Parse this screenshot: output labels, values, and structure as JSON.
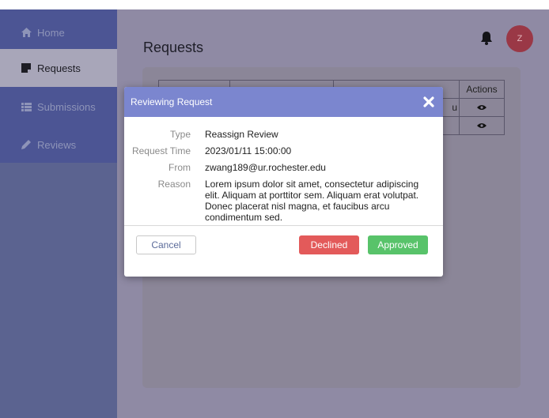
{
  "sidebar": {
    "items": [
      {
        "label": "Home",
        "icon": "home-icon"
      },
      {
        "label": "Requests",
        "icon": "note-icon",
        "active": true
      },
      {
        "label": "Submissions",
        "icon": "list-icon"
      },
      {
        "label": "Reviews",
        "icon": "pencil-icon"
      }
    ]
  },
  "header": {
    "title": "Requests",
    "avatar_initial": "Z"
  },
  "table": {
    "actions_header": "Actions",
    "partial_text": "u"
  },
  "modal": {
    "title": "Reviewing Request",
    "fields": [
      {
        "label": "Type",
        "value": "Reassign Review"
      },
      {
        "label": "Request Time",
        "value": "2023/01/11 15:00:00"
      },
      {
        "label": "From",
        "value": "zwang189@ur.rochester.edu"
      },
      {
        "label": "Reason",
        "value": "Lorem ipsum dolor sit amet, consectetur adipiscing elit. Aliquam at porttitor sem.  Aliquam erat volutpat. Donec placerat nisl magna, et faucibus arcu condimentum sed."
      }
    ],
    "cancel_label": "Cancel",
    "declined_label": "Declined",
    "approved_label": "Approved"
  },
  "colors": {
    "header": "#7b86cf",
    "declined": "#e35a5a",
    "approved": "#58c36a",
    "avatar": "#9a3846"
  }
}
